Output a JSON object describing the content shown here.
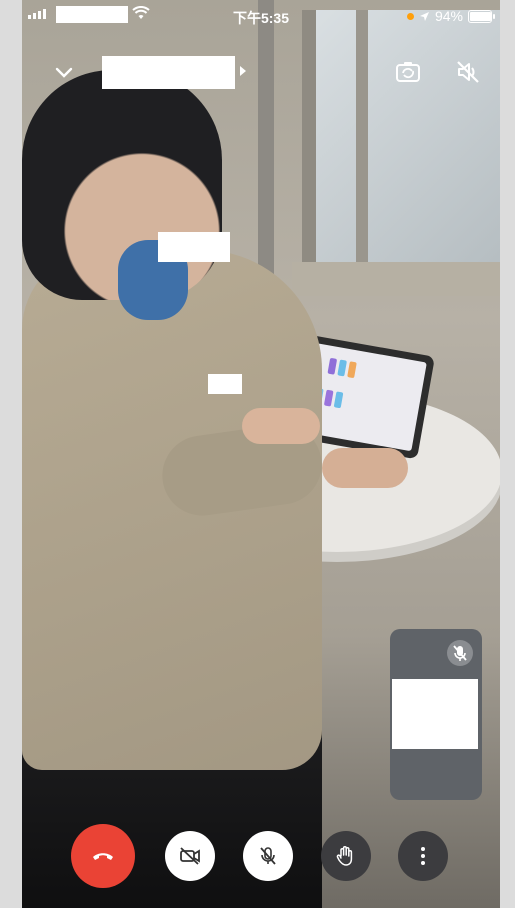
{
  "status_bar": {
    "time": "下午5:35",
    "battery": "94%",
    "battery_level": 0.94
  },
  "meeting": {
    "title": ""
  },
  "self_view": {
    "mic_muted": true
  },
  "controls": {
    "end_call": "end-call",
    "camera": "camera-off",
    "microphone": "mic-off",
    "raise_hand": "raise-hand",
    "more": "more-options"
  },
  "colors": {
    "end_call": "#ea4335",
    "location_dot": "#ff9f0a",
    "self_view_bg": "#5f6368"
  }
}
